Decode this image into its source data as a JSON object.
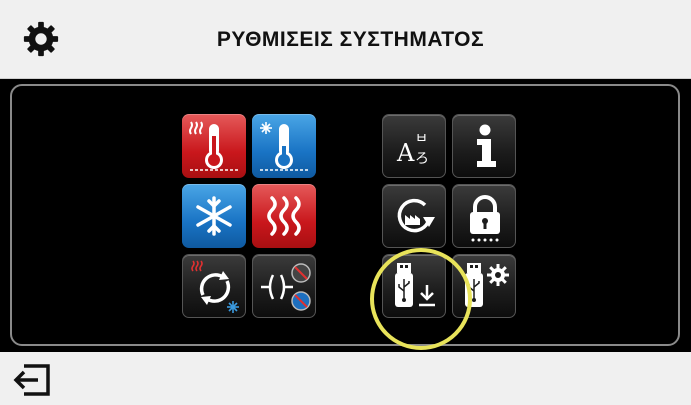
{
  "header": {
    "title": "ΡΥΘΜΙΣΕΙΣ ΣΥΣΤΗΜΑΤΟΣ",
    "icon": "gear-icon"
  },
  "menu": {
    "left_group": [
      {
        "icon": "heating-thermometer-icon",
        "color": "#c9171c"
      },
      {
        "icon": "cooling-thermometer-icon",
        "color": "#1973c4"
      },
      {
        "icon": "snowflake-icon",
        "color": "#1973c4"
      },
      {
        "icon": "heat-waves-icon",
        "color": "#c9171c"
      },
      {
        "icon": "heat-cool-changeover-icon",
        "color": "#1c1c1c"
      },
      {
        "icon": "mode-disable-icon",
        "color": "#1c1c1c"
      }
    ],
    "right_group": [
      {
        "icon": "language-icon",
        "color": "#1c1c1c"
      },
      {
        "icon": "info-icon",
        "color": "#1c1c1c"
      },
      {
        "icon": "factory-reset-icon",
        "color": "#1c1c1c",
        "highlighted": true
      },
      {
        "icon": "lock-icon",
        "color": "#1c1c1c"
      },
      {
        "icon": "usb-download-icon",
        "color": "#1c1c1c"
      },
      {
        "icon": "usb-settings-icon",
        "color": "#1c1c1c"
      }
    ],
    "highlight_color": "#e8e35a"
  },
  "footer": {
    "icon": "exit-icon"
  }
}
